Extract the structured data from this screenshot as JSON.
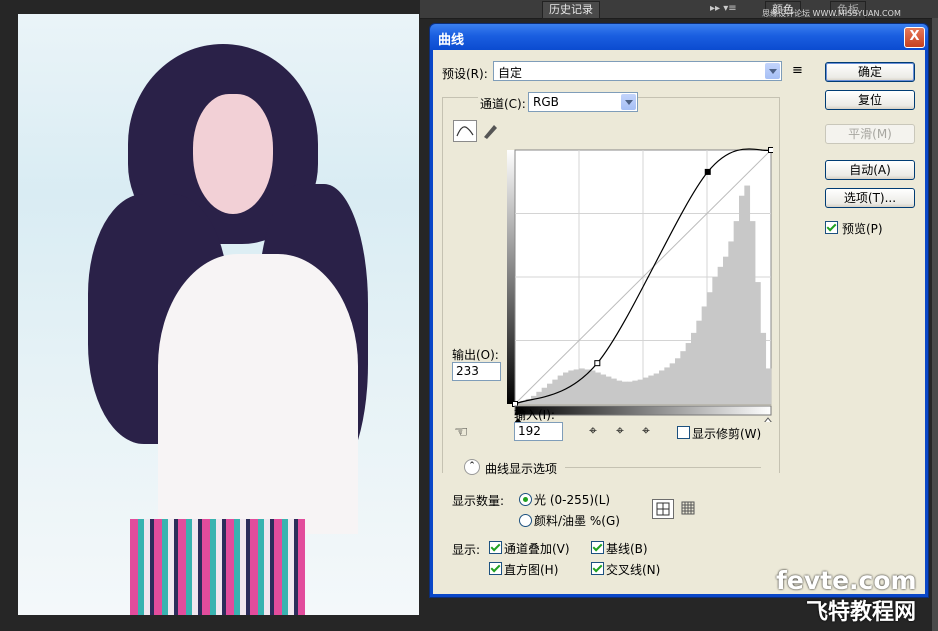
{
  "top_panel": {
    "tab_history": "历史记录",
    "tab_color": "颜色",
    "tab_swatches": "色板",
    "watermark_top": "思缘设计论坛 WWW.MISSYUAN.COM"
  },
  "dialog": {
    "title": "曲线",
    "close": "X",
    "preset_label": "预设(R):",
    "preset_value": "自定",
    "channel_label": "通道(C):",
    "channel_value": "RGB",
    "output_label": "输出(O):",
    "output_value": "233",
    "input_label": "输入(I):",
    "input_value": "192",
    "show_clipping": "显示修剪(W)",
    "display_options": "曲线显示选项",
    "show_amount_label": "显示数量:",
    "light_option": "光 (0-255)(L)",
    "pigment_option": "颜料/油墨 %(G)",
    "show_label": "显示:",
    "channel_overlays": "通道叠加(V)",
    "baseline": "基线(B)",
    "histogram": "直方图(H)",
    "intersection": "交叉线(N)",
    "buttons": {
      "ok": "确定",
      "reset": "复位",
      "smooth": "平滑(M)",
      "auto": "自动(A)",
      "options": "选项(T)...",
      "preview": "预览(P)"
    }
  },
  "watermark": {
    "line1": "fevte.com",
    "line2": "飞特教程网"
  },
  "colors": {
    "title_blue": "#0b4bd0",
    "dialog_bg": "#ece9d8",
    "check_green": "#21a121",
    "histogram_gray": "#c8c8c8"
  },
  "chart_data": {
    "type": "line",
    "title": "",
    "xlim": [
      0,
      255
    ],
    "ylim": [
      0,
      255
    ],
    "curve_points": [
      [
        0,
        0
      ],
      [
        82,
        41
      ],
      [
        192,
        233
      ],
      [
        255,
        255
      ]
    ],
    "histogram": [
      2,
      3,
      5,
      8,
      12,
      16,
      20,
      24,
      28,
      31,
      33,
      34,
      35,
      34,
      33,
      31,
      29,
      27,
      25,
      23,
      22,
      22,
      23,
      24,
      26,
      28,
      30,
      33,
      36,
      40,
      45,
      52,
      60,
      70,
      82,
      96,
      110,
      125,
      135,
      145,
      160,
      180,
      205,
      215,
      180,
      120,
      70,
      35
    ]
  }
}
